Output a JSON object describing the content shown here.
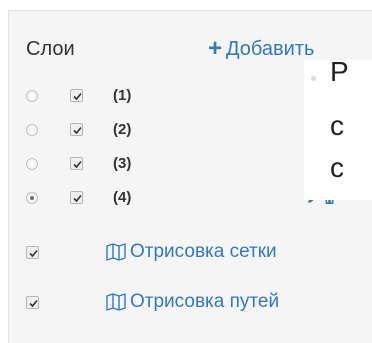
{
  "header": {
    "title": "Слои",
    "add_label": "Добавить"
  },
  "layers": [
    {
      "name": "(1)",
      "visible": true,
      "active": false
    },
    {
      "name": "(2)",
      "visible": true,
      "active": false
    },
    {
      "name": "(3)",
      "visible": true,
      "active": false
    },
    {
      "name": "(4)",
      "visible": true,
      "active": true
    }
  ],
  "toggles": [
    {
      "label": "Отрисовка сетки",
      "checked": true
    },
    {
      "label": "Отрисовка путей",
      "checked": true
    }
  ],
  "tooltip": {
    "lines": [
      "Р",
      "с",
      "с"
    ]
  },
  "colors": {
    "link": "#337ab7",
    "panel_background": "#f5f5f5",
    "text": "#333333"
  },
  "icons": [
    "plus-icon",
    "pencil-icon",
    "trash-icon",
    "map-icon"
  ]
}
